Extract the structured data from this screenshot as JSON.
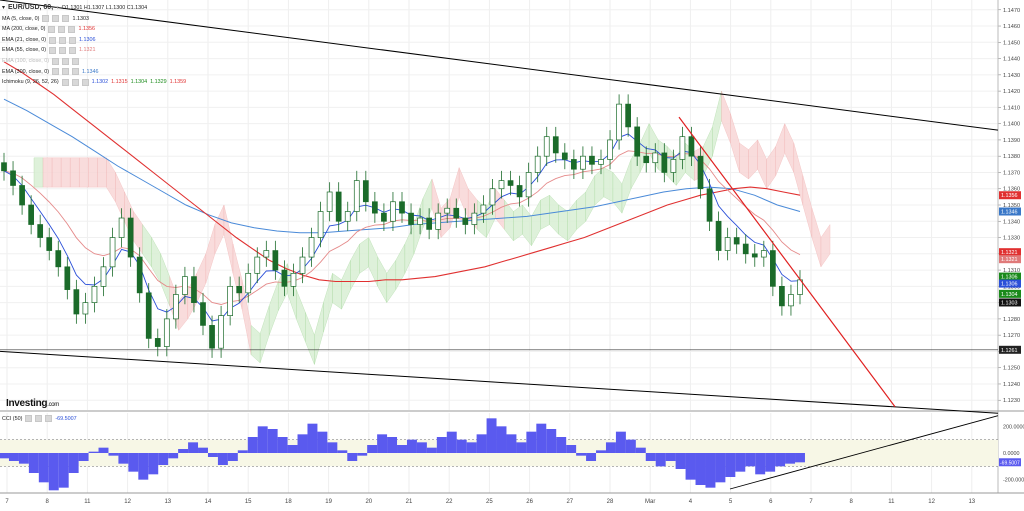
{
  "header": {
    "symbol": "EUR/USD, 60,",
    "ohlc": "O1.1301  H1.1307  L1.1300  C1.1304"
  },
  "indicators": [
    {
      "label": "MA (5, close, 0)",
      "value": "1.1303",
      "color": "#222222"
    },
    {
      "label": "MA (200, close, 0)",
      "value": "1.1356",
      "color": "#e03030"
    },
    {
      "label": "EMA (21, close, 0)",
      "value": "1.1306",
      "color": "#2a4fd8"
    },
    {
      "label": "EMA (55, close, 0)",
      "value": "1.1321",
      "color": "#e07a7a"
    },
    {
      "label": "EMA (100, close, 0)",
      "value": "",
      "color": "#bbbbbb"
    },
    {
      "label": "EMA (300, close, 0)",
      "value": "1.1346",
      "color": "#3a78c8"
    },
    {
      "label": "Ichimoku (9, 26, 52, 26)",
      "values": [
        "1.1302",
        "1.1315",
        "1.1304",
        "1.1329",
        "1.1359"
      ],
      "colors": [
        "#2a4fd8",
        "#e03030",
        "#1a8a1a",
        "#1a8a1a",
        "#e03030"
      ]
    }
  ],
  "brand": {
    "name": "Investing",
    "suffix": ".com"
  },
  "oscillator": {
    "label": "CCI (50)",
    "value": "-69.5007"
  },
  "colors": {
    "ma200": "#e03030",
    "ema21": "#2a4fd8",
    "ema55": "#e58a8a",
    "ema300": "#4a8ad8",
    "ma5": "#111111",
    "cloud_bull": "#d9efd4",
    "cloud_bear": "#f8d7d7",
    "candle": "#1b6b2a",
    "cci": "#5a5aef",
    "channel": "#000000",
    "trend_red": "#e02020"
  },
  "chart_data": {
    "type": "line",
    "instrument": "EUR/USD",
    "timeframe": "60",
    "x_tick_labels": [
      "7",
      "8",
      "11",
      "12",
      "13",
      "14",
      "15",
      "18",
      "19",
      "20",
      "21",
      "22",
      "25",
      "26",
      "27",
      "28",
      "Mar",
      "4",
      "5",
      "6",
      "7",
      "8",
      "11",
      "12",
      "13"
    ],
    "y_ticks": [
      "1.1470",
      "1.1460",
      "1.1450",
      "1.1440",
      "1.1430",
      "1.1420",
      "1.1410",
      "1.1400",
      "1.1390",
      "1.1380",
      "1.1370",
      "1.1360",
      "1.1350",
      "1.1340",
      "1.1330",
      "1.1320",
      "1.1310",
      "1.1300",
      "1.1290",
      "1.1280",
      "1.1270",
      "1.1260",
      "1.1250",
      "1.1240",
      "1.1230"
    ],
    "ylim": [
      1.1224,
      1.1476
    ],
    "price_close": [
      1.1371,
      1.1362,
      1.135,
      1.1338,
      1.133,
      1.1322,
      1.1312,
      1.1298,
      1.1283,
      1.129,
      1.13,
      1.1312,
      1.133,
      1.1342,
      1.1318,
      1.1296,
      1.1268,
      1.1263,
      1.128,
      1.1295,
      1.1306,
      1.129,
      1.1276,
      1.1262,
      1.1282,
      1.13,
      1.1296,
      1.1308,
      1.1318,
      1.1322,
      1.131,
      1.13,
      1.1308,
      1.1318,
      1.133,
      1.1346,
      1.1358,
      1.134,
      1.1346,
      1.1365,
      1.1352,
      1.1345,
      1.134,
      1.1352,
      1.1345,
      1.1338,
      1.1342,
      1.1335,
      1.1345,
      1.1348,
      1.1342,
      1.1338,
      1.1345,
      1.135,
      1.136,
      1.1365,
      1.1362,
      1.1355,
      1.137,
      1.138,
      1.1392,
      1.1382,
      1.1378,
      1.1372,
      1.138,
      1.1375,
      1.1378,
      1.139,
      1.1412,
      1.1398,
      1.138,
      1.1376,
      1.1382,
      1.137,
      1.1378,
      1.1392,
      1.138,
      1.136,
      1.134,
      1.1322,
      1.133,
      1.1326,
      1.132,
      1.1318,
      1.1322,
      1.13,
      1.1288,
      1.1295,
      1.1304
    ],
    "ma200": [
      1.1438,
      1.1432,
      1.1425,
      1.1418,
      1.141,
      1.1402,
      1.1394,
      1.1386,
      1.1378,
      1.137,
      1.1362,
      1.1354,
      1.1346,
      1.1338,
      1.133,
      1.1323,
      1.1316,
      1.1311,
      1.1307,
      1.1304,
      1.1303,
      1.1303,
      1.1303,
      1.1304,
      1.1304,
      1.1305,
      1.1306,
      1.1308,
      1.131,
      1.1312,
      1.1315,
      1.1318,
      1.1321,
      1.1324,
      1.1327,
      1.133,
      1.1334,
      1.1338,
      1.1342,
      1.1346,
      1.135,
      1.1353,
      1.1356,
      1.1358,
      1.136,
      1.1361,
      1.136,
      1.1358,
      1.1356
    ],
    "ema300": [
      1.1415,
      1.1408,
      1.14,
      1.1392,
      1.1383,
      1.1374,
      1.1366,
      1.1358,
      1.135,
      1.1344,
      1.1339,
      1.1336,
      1.1334,
      1.1333,
      1.1333,
      1.1334,
      1.1335,
      1.1336,
      1.1338,
      1.1339,
      1.134,
      1.1341,
      1.1342,
      1.1343,
      1.1345,
      1.1347,
      1.1349,
      1.1352,
      1.1355,
      1.1358,
      1.136,
      1.1361,
      1.136,
      1.1356,
      1.135,
      1.1346
    ],
    "channel_top": {
      "from": {
        "x": "start",
        "y": 1.1476
      },
      "to": {
        "x": "end",
        "y": 1.1396
      }
    },
    "channel_bottom": {
      "from": {
        "x": "start",
        "y": 1.126
      },
      "to": {
        "x": "end",
        "y": 1.1222
      }
    },
    "support": 1.1261,
    "price_labels": [
      {
        "text": "1.1356",
        "bg": "#e03030"
      },
      {
        "text": "1.1346",
        "bg": "#3a78c8"
      },
      {
        "text": "1.1321",
        "bg": "#e03030"
      },
      {
        "text": "1.1321",
        "bg": "#e07a7a"
      },
      {
        "text": "1.1306",
        "bg": "#1a8a1a"
      },
      {
        "text": "1.1306",
        "bg": "#2a4fd8"
      },
      {
        "text": "1.1304",
        "bg": "#1a8a1a"
      },
      {
        "text": "1.1303",
        "bg": "#111111"
      },
      {
        "text": "1.1261",
        "bg": "#222222"
      }
    ],
    "cci": {
      "y_ticks": [
        "200.0000",
        "0.0000",
        "-200.0000"
      ],
      "ylim": [
        -300,
        300
      ],
      "levels": [
        100,
        -100
      ],
      "last": -69.5007,
      "values": [
        -40,
        -60,
        -80,
        -150,
        -220,
        -280,
        -260,
        -150,
        -60,
        10,
        40,
        -20,
        -80,
        -140,
        -200,
        -160,
        -90,
        -40,
        30,
        80,
        40,
        -30,
        -90,
        -60,
        20,
        120,
        200,
        180,
        120,
        60,
        140,
        220,
        160,
        80,
        20,
        -60,
        -20,
        60,
        140,
        120,
        60,
        100,
        80,
        40,
        120,
        160,
        100,
        80,
        140,
        260,
        200,
        140,
        80,
        160,
        220,
        180,
        120,
        60,
        -20,
        -60,
        20,
        80,
        160,
        100,
        40,
        -60,
        -100,
        -60,
        -120,
        -200,
        -240,
        -260,
        -220,
        -180,
        -140,
        -100,
        -160,
        -140,
        -100,
        -80,
        -70
      ]
    }
  }
}
